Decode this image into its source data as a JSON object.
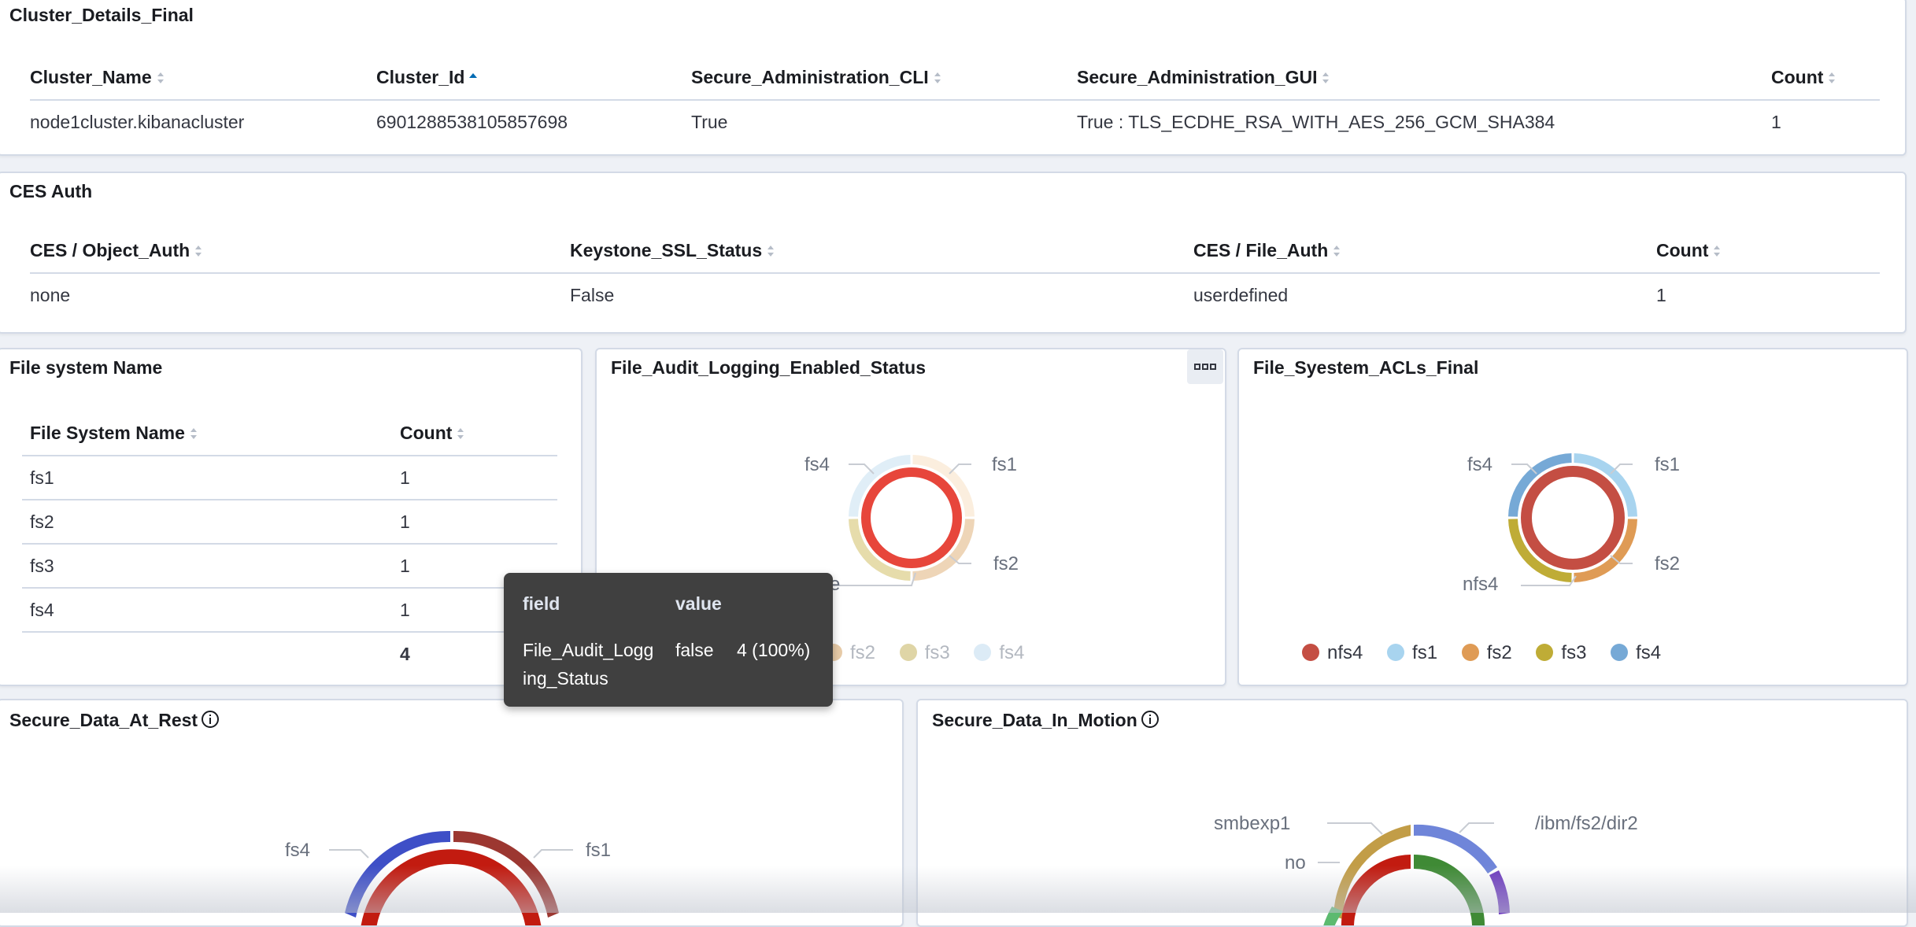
{
  "cluster_details": {
    "title": "Cluster_Details_Final",
    "columns": [
      "Cluster_Name",
      "Cluster_Id",
      "Secure_Administration_CLI",
      "Secure_Administration_GUI",
      "Count"
    ],
    "sorted_column": "Cluster_Id",
    "rows": [
      [
        "node1cluster.kibanacluster",
        "6901288538105857698",
        "True",
        "True : TLS_ECDHE_RSA_WITH_AES_256_GCM_SHA384",
        "1"
      ]
    ]
  },
  "ces_auth": {
    "title": "CES Auth",
    "columns": [
      "CES / Object_Auth",
      "Keystone_SSL_Status",
      "CES / File_Auth",
      "Count"
    ],
    "rows": [
      [
        "none",
        "False",
        "userdefined",
        "1"
      ]
    ]
  },
  "fs_name": {
    "title": "File system Name",
    "columns": [
      "File System Name",
      "Count"
    ],
    "rows": [
      [
        "fs1",
        "1"
      ],
      [
        "fs2",
        "1"
      ],
      [
        "fs3",
        "1"
      ],
      [
        "fs4",
        "1"
      ]
    ],
    "total": "4"
  },
  "audit_chart": {
    "title": "File_Audit_Logging_Enabled_Status",
    "labels": [
      "fs4",
      "fs1",
      "fs2",
      "e"
    ],
    "legend": [
      "fs2",
      "fs3",
      "fs4"
    ],
    "legend_colors": [
      "#e7cba8",
      "#dfd5a6",
      "#dcebf6"
    ]
  },
  "acl_chart": {
    "title": "File_Syestem_ACLs_Final",
    "labels": [
      "fs4",
      "fs1",
      "fs2",
      "nfs4"
    ],
    "legend": [
      "nfs4",
      "fs1",
      "fs2",
      "fs3",
      "fs4"
    ],
    "legend_colors": [
      "#c44e43",
      "#a8d4ef",
      "#df9b55",
      "#bfac36",
      "#76a9d6"
    ]
  },
  "rest_chart": {
    "title": "Secure_Data_At_Rest",
    "labels": [
      "fs4",
      "fs1"
    ]
  },
  "motion_chart": {
    "title": "Secure_Data_In_Motion",
    "labels": [
      "smbexp1",
      "/ibm/fs2/dir2",
      "no"
    ]
  },
  "tooltip": {
    "header_field": "field",
    "header_value": "value",
    "field_line1": "File_Audit_Logg",
    "field_line2": "ing_Status",
    "value": "false",
    "count": "4 (100%)"
  },
  "chart_data": [
    {
      "type": "pie",
      "title": "File_Audit_Logging_Enabled_Status",
      "inner": {
        "labels": [
          "false"
        ],
        "values": [
          4
        ]
      },
      "outer": {
        "labels": [
          "fs1",
          "fs2",
          "fs3",
          "fs4"
        ],
        "values": [
          1,
          1,
          1,
          1
        ]
      }
    },
    {
      "type": "pie",
      "title": "File_Syestem_ACLs_Final",
      "inner": {
        "labels": [
          "nfs4"
        ],
        "values": [
          4
        ]
      },
      "outer": {
        "labels": [
          "fs1",
          "fs2",
          "fs3",
          "fs4"
        ],
        "values": [
          1,
          1,
          1,
          1
        ]
      }
    }
  ]
}
